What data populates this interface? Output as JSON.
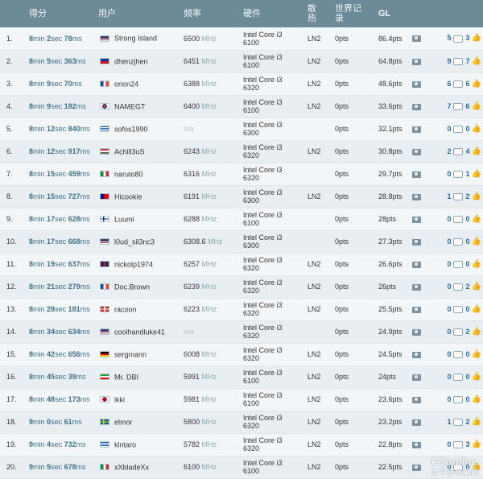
{
  "header": {
    "score": "得分",
    "user": "用户",
    "freq": "频率",
    "hardware": "硬件",
    "cooling": "散热",
    "worldrecord": "世界记录",
    "gl": "GL"
  },
  "rows": [
    {
      "rank": "1.",
      "min": "8",
      "sec": "2",
      "ms": "78",
      "flag": "us",
      "user": "Strong Island",
      "freq": "6500",
      "freq_unit": "MHz",
      "hw1": "Intel Core i3",
      "hw2": "6100",
      "cool": "LN2",
      "wr": "0pts",
      "pts": "86.4pts",
      "comments": "5",
      "likes": "3"
    },
    {
      "rank": "2.",
      "min": "8",
      "sec": "5",
      "ms": "363",
      "flag": "ph",
      "user": "dhenzjhen",
      "freq": "6451",
      "freq_unit": "MHz",
      "hw1": "Intel Core i3",
      "hw2": "6100",
      "cool": "LN2",
      "wr": "0pts",
      "pts": "64.8pts",
      "comments": "9",
      "likes": "7"
    },
    {
      "rank": "3.",
      "min": "8",
      "sec": "9",
      "ms": "70",
      "flag": "fr",
      "user": "orion24",
      "freq": "6388",
      "freq_unit": "MHz",
      "hw1": "Intel Core i3",
      "hw2": "6320",
      "cool": "LN2",
      "wr": "0pts",
      "pts": "48.6pts",
      "comments": "6",
      "likes": "6"
    },
    {
      "rank": "4.",
      "min": "8",
      "sec": "9",
      "ms": "182",
      "flag": "kr",
      "user": "NAMEGT",
      "freq": "6400",
      "freq_unit": "MHz",
      "hw1": "Intel Core i3",
      "hw2": "6100",
      "cool": "LN2",
      "wr": "0pts",
      "pts": "33.6pts",
      "comments": "7",
      "likes": "6"
    },
    {
      "rank": "5.",
      "min": "8",
      "sec": "12",
      "ms": "840",
      "flag": "gr",
      "user": "sofos1990",
      "freq": "n/a",
      "freq_unit": "",
      "hw1": "Intel Core i3",
      "hw2": "6300",
      "cool": "",
      "wr": "0pts",
      "pts": "32.1pts",
      "comments": "0",
      "likes": "0"
    },
    {
      "rank": "6.",
      "min": "8",
      "sec": "12",
      "ms": "917",
      "flag": "hu",
      "user": "Achill3uS",
      "freq": "6243",
      "freq_unit": "MHz",
      "hw1": "Intel Core i3",
      "hw2": "6320",
      "cool": "LN2",
      "wr": "0pts",
      "pts": "30.8pts",
      "comments": "2",
      "likes": "4"
    },
    {
      "rank": "7.",
      "min": "8",
      "sec": "15",
      "ms": "459",
      "flag": "it",
      "user": "naruto80",
      "freq": "6316",
      "freq_unit": "MHz",
      "hw1": "Intel Core i3",
      "hw2": "6320",
      "cool": "",
      "wr": "0pts",
      "pts": "29.7pts",
      "comments": "0",
      "likes": "1"
    },
    {
      "rank": "8.",
      "min": "8",
      "sec": "15",
      "ms": "727",
      "flag": "tw",
      "user": "Hicookie",
      "freq": "6191",
      "freq_unit": "MHz",
      "hw1": "Intel Core i3",
      "hw2": "6300",
      "cool": "LN2",
      "wr": "0pts",
      "pts": "28.8pts",
      "comments": "1",
      "likes": "2"
    },
    {
      "rank": "9.",
      "min": "8",
      "sec": "17",
      "ms": "628",
      "flag": "fi",
      "user": "Luumi",
      "freq": "6288",
      "freq_unit": "MHz",
      "hw1": "Intel Core i3",
      "hw2": "6100",
      "cool": "",
      "wr": "0pts",
      "pts": "28pts",
      "comments": "0",
      "likes": "0"
    },
    {
      "rank": "10.",
      "min": "8",
      "sec": "17",
      "ms": "668",
      "flag": "us",
      "user": "l0ud_sil3nc3",
      "freq": "6308.6",
      "freq_unit": "MHz",
      "hw1": "Intel Core i3",
      "hw2": "6300",
      "cool": "",
      "wr": "0pts",
      "pts": "27.3pts",
      "comments": "0",
      "likes": "0"
    },
    {
      "rank": "11.",
      "min": "8",
      "sec": "19",
      "ms": "637",
      "flag": "gb",
      "user": "nickolp1974",
      "freq": "6257",
      "freq_unit": "MHz",
      "hw1": "Intel Core i3",
      "hw2": "6320",
      "cool": "LN2",
      "wr": "0pts",
      "pts": "26.6pts",
      "comments": "0",
      "likes": "0"
    },
    {
      "rank": "12.",
      "min": "8",
      "sec": "21",
      "ms": "279",
      "flag": "fr",
      "user": "Doc.Brown",
      "freq": "6239",
      "freq_unit": "MHz",
      "hw1": "Intel Core i3",
      "hw2": "6320",
      "cool": "LN2",
      "wr": "0pts",
      "pts": "26pts",
      "comments": "0",
      "likes": "2"
    },
    {
      "rank": "13.",
      "min": "8",
      "sec": "28",
      "ms": "181",
      "flag": "ch",
      "user": "racoon",
      "freq": "6223",
      "freq_unit": "MHz",
      "hw1": "Intel Core i3",
      "hw2": "6320",
      "cool": "LN2",
      "wr": "0pts",
      "pts": "25.5pts",
      "comments": "0",
      "likes": "0"
    },
    {
      "rank": "14.",
      "min": "8",
      "sec": "34",
      "ms": "634",
      "flag": "us",
      "user": "coolhandluke41",
      "freq": "n/a",
      "freq_unit": "",
      "hw1": "Intel Core i3",
      "hw2": "6320",
      "cool": "",
      "wr": "0pts",
      "pts": "24.9pts",
      "comments": "0",
      "likes": "2"
    },
    {
      "rank": "15.",
      "min": "8",
      "sec": "42",
      "ms": "656",
      "flag": "de",
      "user": "sergmann",
      "freq": "6008",
      "freq_unit": "MHz",
      "hw1": "Intel Core i3",
      "hw2": "6320",
      "cool": "LN2",
      "wr": "0pts",
      "pts": "24.5pts",
      "comments": "0",
      "likes": "0"
    },
    {
      "rank": "16.",
      "min": "8",
      "sec": "45",
      "ms": "39",
      "flag": "ir",
      "user": "Mr. DBI",
      "freq": "5991",
      "freq_unit": "MHz",
      "hw1": "Intel Core i3",
      "hw2": "6100",
      "cool": "LN2",
      "wr": "0pts",
      "pts": "24pts",
      "comments": "0",
      "likes": "0"
    },
    {
      "rank": "17.",
      "min": "8",
      "sec": "48",
      "ms": "173",
      "flag": "jp",
      "user": "ikki",
      "freq": "5981",
      "freq_unit": "MHz",
      "hw1": "Intel Core i3",
      "hw2": "6100",
      "cool": "LN2",
      "wr": "0pts",
      "pts": "23.6pts",
      "comments": "0",
      "likes": "0"
    },
    {
      "rank": "18.",
      "min": "9",
      "sec": "0",
      "ms": "61",
      "flag": "se",
      "user": "elmor",
      "freq": "5800",
      "freq_unit": "MHz",
      "hw1": "Intel Core i3",
      "hw2": "6320",
      "cool": "LN2",
      "wr": "0pts",
      "pts": "23.2pts",
      "comments": "1",
      "likes": "2"
    },
    {
      "rank": "19.",
      "min": "9",
      "sec": "4",
      "ms": "732",
      "flag": "gr",
      "user": "kintaro",
      "freq": "5782",
      "freq_unit": "MHz",
      "hw1": "Intel Core i3",
      "hw2": "6320",
      "cool": "LN2",
      "wr": "0pts",
      "pts": "22.8pts",
      "comments": "0",
      "likes": "3"
    },
    {
      "rank": "20.",
      "min": "9",
      "sec": "5",
      "ms": "678",
      "flag": "it",
      "user": "xXbladeXx",
      "freq": "6100",
      "freq_unit": "MHz",
      "hw1": "Intel Core i3",
      "hw2": "6100",
      "cool": "LN2",
      "wr": "0pts",
      "pts": "22.5pts",
      "comments": "0",
      "likes": "0"
    }
  ],
  "units": {
    "min": "min",
    "sec": "sec",
    "ms": "ms"
  },
  "watermark": {
    "text": "PConline",
    "sub": "太平洋电脑网"
  },
  "icons": {
    "camera": "camera-icon",
    "comment": "comment-icon",
    "like": "thumbs-up-icon"
  },
  "colors": {
    "header_bg": "#6d8a99",
    "score_text": "#3f6f87",
    "like_blue": "#2a7fc0"
  }
}
